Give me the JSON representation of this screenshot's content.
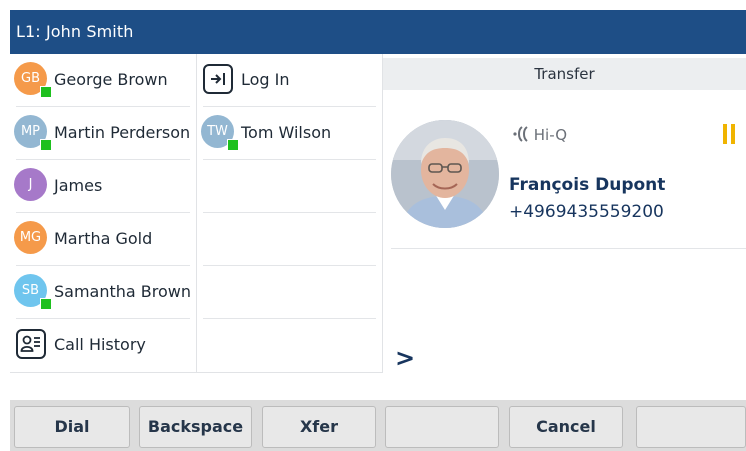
{
  "titlebar": {
    "title": "L1: John Smith"
  },
  "contacts": [
    {
      "initials": "GB",
      "name": "George Brown",
      "color": "#f59a4a",
      "online": true
    },
    {
      "initials": "MP",
      "name": "Martin Perderson",
      "color": "#93b7d2",
      "online": true
    },
    {
      "initials": "J",
      "name": "James",
      "color": "#a679c9",
      "online": false
    },
    {
      "initials": "MG",
      "name": "Martha Gold",
      "color": "#f59a4a",
      "online": false
    },
    {
      "initials": "SB",
      "name": "Samantha Brown",
      "color": "#6fc5ee",
      "online": true
    }
  ],
  "call_history": {
    "label": "Call History",
    "icon": "contact-card-icon"
  },
  "column2": {
    "login": {
      "label": "Log In",
      "icon": "login-arrow-icon"
    },
    "tom": {
      "initials": "TW",
      "name": "Tom Wilson",
      "color": "#93b7d2",
      "online": true
    }
  },
  "call_panel": {
    "header": "Transfer",
    "hiq": "Hi-Q",
    "caller_name": "François Dupont",
    "caller_number": "+4969435559200",
    "prompt": ">",
    "status_icon": "pause-icon",
    "status_color": "#f0b400"
  },
  "softkeys": [
    "Dial",
    "Backspace",
    "Xfer",
    "",
    "Cancel",
    ""
  ],
  "colors": {
    "titlebar": "#1e4e86",
    "presence": "#1ec01e",
    "text_dark": "#17355e"
  }
}
